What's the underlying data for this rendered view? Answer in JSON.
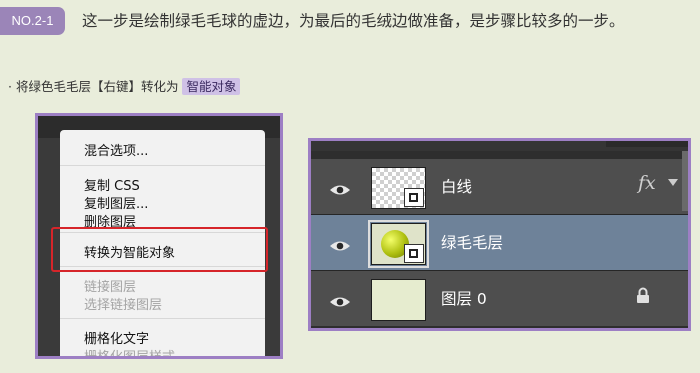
{
  "header": {
    "step_label": "NO.2-1",
    "title": "这一步是绘制绿毛毛球的虚边，为最后的毛绒边做准备，是步骤比较多的一步。"
  },
  "instruction": {
    "prefix": "· 将绿色毛毛层【右键】转化为",
    "highlight": "智能对象"
  },
  "context_menu": {
    "items": [
      {
        "label": "混合选项...",
        "enabled": true
      },
      {
        "label": "复制 CSS",
        "enabled": true
      },
      {
        "label": "复制图层...",
        "enabled": true
      },
      {
        "label": "删除图层",
        "enabled": true
      },
      {
        "label": "转换为智能对象",
        "enabled": true,
        "highlighted": true
      },
      {
        "label": "链接图层",
        "enabled": false
      },
      {
        "label": "选择链接图层",
        "enabled": false
      },
      {
        "label": "栅格化文字",
        "enabled": true
      },
      {
        "label": "栅格化图层样式",
        "enabled": false
      }
    ]
  },
  "layers_panel": {
    "layers": [
      {
        "name": "白线",
        "visible": true,
        "thumbnail": "transparent-checker",
        "smart_object": true,
        "has_fx": true,
        "fx_label": "fx",
        "selected": false,
        "locked": false
      },
      {
        "name": "绿毛毛层",
        "visible": true,
        "thumbnail": "green-ball",
        "smart_object": true,
        "has_fx": false,
        "selected": true,
        "locked": false
      },
      {
        "name": "图层 0",
        "visible": true,
        "thumbnail": "solid-light",
        "smart_object": false,
        "has_fx": false,
        "selected": false,
        "locked": true
      }
    ]
  },
  "colors": {
    "page_background": "#e9eddb",
    "badge": "#9b85b8",
    "frame_border": "#9d7fc4",
    "highlight_border": "#d6252a",
    "selected_layer": "#6e8299"
  }
}
